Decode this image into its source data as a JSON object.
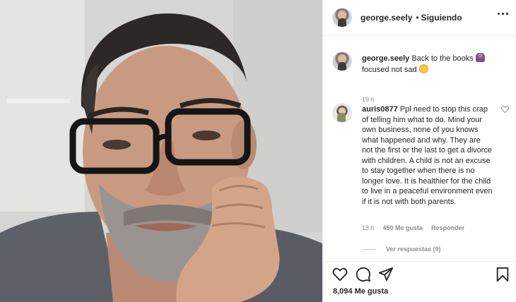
{
  "post": {
    "author": "george.seely",
    "follow_separator": "•",
    "follow_status": "Siguiendo",
    "caption_text": "Back to the books",
    "caption_text_2": "focused not sad",
    "caption_time": "19 h",
    "likes": "8,094 Me gusta"
  },
  "comments": [
    {
      "user": "auris0877",
      "text": "Ppl need to stop this crap of telling him what to do. Mind your own business, none of you knows what happened and why. They are not the first or the last to get a divorce with children. A child is not an excuse to stay together when there is no longer love. It is healthier for the child to live in a peaceful environment even if it is not with both parents.",
      "time": "18 h",
      "likes": "450 Me gusta",
      "reply_label": "Responder",
      "replies_label": "Ver respuestas (9)"
    }
  ],
  "icons": {
    "more": "more-options-icon",
    "like": "heart-icon",
    "comment": "comment-icon",
    "share": "share-icon",
    "save": "bookmark-icon",
    "comment_like": "small-heart-icon",
    "emoji_1": "woman-bowing-emoji",
    "emoji_2": "pleading-face-emoji"
  },
  "colors": {
    "text": "#262626",
    "secondary": "#8e8e8e",
    "border": "#efefef"
  }
}
